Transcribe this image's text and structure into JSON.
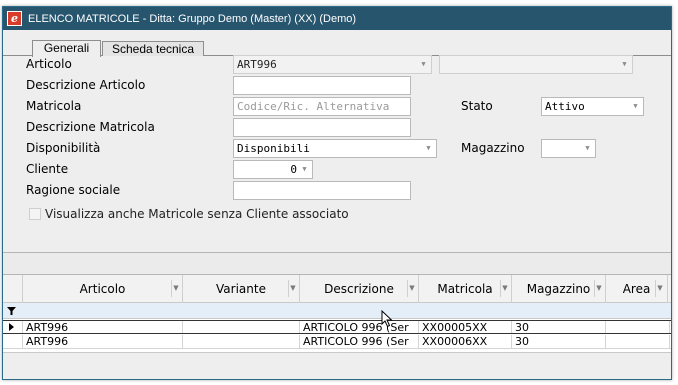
{
  "window": {
    "title": "ELENCO MATRICOLE - Ditta: Gruppo Demo (Master) (XX)  (Demo)",
    "app_icon_glyph": "e"
  },
  "tabs": [
    {
      "label": "Generali",
      "active": true
    },
    {
      "label": "Scheda tecnica",
      "active": false
    }
  ],
  "form": {
    "articolo": {
      "label": "Articolo",
      "value": "ART996",
      "secondary_value": ""
    },
    "descrizione_articolo": {
      "label": "Descrizione Articolo",
      "value": ""
    },
    "matricola": {
      "label": "Matricola",
      "value": "",
      "placeholder": "Codice/Ric. Alternativa"
    },
    "stato": {
      "label": "Stato",
      "value": "Attivo"
    },
    "descrizione_matricola": {
      "label": "Descrizione Matricola",
      "value": ""
    },
    "disponibilita": {
      "label": "Disponibilità",
      "value": "Disponibili"
    },
    "magazzino": {
      "label": "Magazzino",
      "value": ""
    },
    "cliente": {
      "label": "Cliente",
      "value": "0"
    },
    "ragione_sociale": {
      "label": "Ragione sociale",
      "value": ""
    },
    "checkbox_label": "Visualizza anche Matricole senza Cliente associato",
    "checkbox_checked": false
  },
  "grid": {
    "columns": [
      "Articolo",
      "Variante",
      "Descrizione",
      "Matricola",
      "Magazzino",
      "Area"
    ],
    "rows": [
      {
        "articolo": "ART996",
        "variante": "",
        "descrizione": "ARTICOLO 996 (Ser",
        "matricola": "XX00005XX",
        "magazzino": "30",
        "area": "",
        "current": true
      },
      {
        "articolo": "ART996",
        "variante": "",
        "descrizione": "ARTICOLO 996 (Ser",
        "matricola": "XX00006XX",
        "magazzino": "30",
        "area": "",
        "current": false
      }
    ]
  },
  "colors": {
    "titlebar": "#27556e",
    "window_bg": "#eeeeee",
    "filter_row": "#e4eef8"
  }
}
